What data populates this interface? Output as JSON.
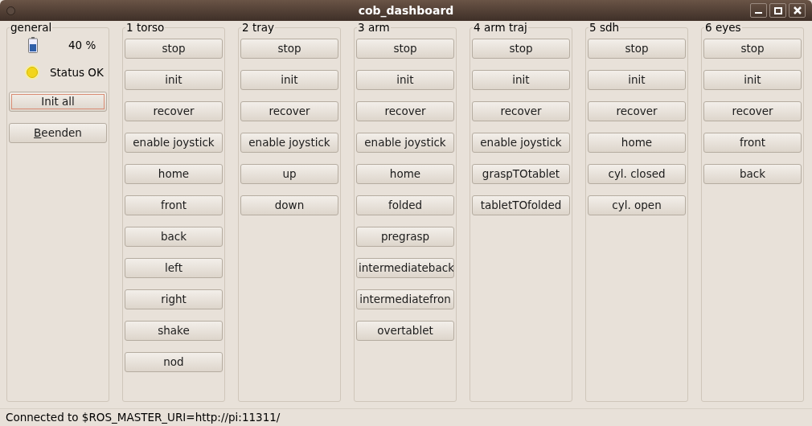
{
  "window": {
    "title": "cob_dashboard"
  },
  "general": {
    "title": "general",
    "battery_reading": "40 %",
    "status": "Status OK",
    "buttons": [
      {
        "label": "Init all",
        "focused": true,
        "mnemonic": false
      },
      {
        "label": "Beenden",
        "focused": false,
        "mnemonic": true
      }
    ]
  },
  "groups": [
    {
      "title": "1 torso",
      "buttons": [
        "stop",
        "init",
        "recover",
        "enable joystick",
        "home",
        "front",
        "back",
        "left",
        "right",
        "shake",
        "nod"
      ]
    },
    {
      "title": "2 tray",
      "buttons": [
        "stop",
        "init",
        "recover",
        "enable joystick",
        "up",
        "down"
      ]
    },
    {
      "title": "3 arm",
      "buttons": [
        "stop",
        "init",
        "recover",
        "enable joystick",
        "home",
        "folded",
        "pregrasp",
        "intermediateback",
        "intermediatefron",
        "overtablet"
      ]
    },
    {
      "title": "4 arm traj",
      "buttons": [
        "stop",
        "init",
        "recover",
        "enable joystick",
        "graspTOtablet",
        "tabletTOfolded"
      ]
    },
    {
      "title": "5 sdh",
      "buttons": [
        "stop",
        "init",
        "recover",
        "home",
        "cyl. closed",
        "cyl. open"
      ]
    },
    {
      "title": "6 eyes",
      "buttons": [
        "stop",
        "init",
        "recover",
        "front",
        "back"
      ]
    }
  ],
  "status_bar": "Connected to $ROS_MASTER_URI=http://pi:11311/"
}
